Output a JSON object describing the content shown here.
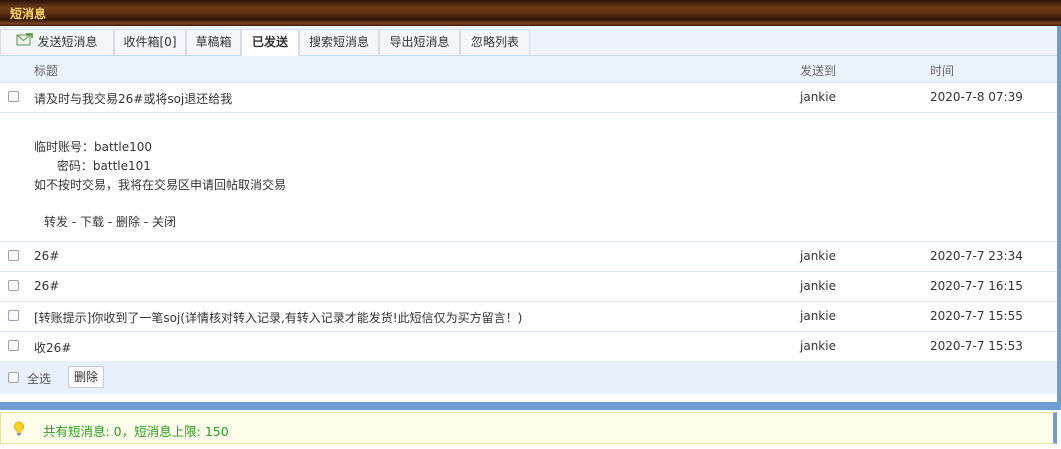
{
  "header": {
    "title": "短消息"
  },
  "tabs": [
    {
      "label": "发送短消息",
      "icon": "compose-envelope-icon"
    },
    {
      "label": "收件箱[0]"
    },
    {
      "label": "草稿箱"
    },
    {
      "label": "已发送",
      "active": true
    },
    {
      "label": "搜索短消息"
    },
    {
      "label": "导出短消息"
    },
    {
      "label": "忽略列表"
    }
  ],
  "columns": {
    "subject": "标题",
    "to": "发送到",
    "time": "时间"
  },
  "messages": [
    {
      "subject": "请及时与我交易26#或将soj退还给我",
      "to": "jankie",
      "time": "2020-7-8 07:39"
    },
    {
      "subject": "26#",
      "to": "jankie",
      "time": "2020-7-7 23:34"
    },
    {
      "subject": "26#",
      "to": "jankie",
      "time": "2020-7-7 16:15"
    },
    {
      "subject": "[转账提示]你收到了一笔soj(详情核对转入记录,有转入记录才能发货!此短信仅为买方留言！)",
      "to": "jankie",
      "time": "2020-7-7 15:55"
    },
    {
      "subject": "收26#",
      "to": "jankie",
      "time": "2020-7-7 15:53"
    }
  ],
  "detail": {
    "lines": [
      "临时账号：battle100",
      "      密码：battle101",
      "如不按时交易，我将在交易区申请回帖取消交易"
    ],
    "actions": {
      "forward": "转发",
      "download": "下载",
      "delete": "删除",
      "close": "关闭",
      "sep": " - "
    }
  },
  "footer": {
    "select_all": "全选",
    "delete_button": "删除"
  },
  "notice": {
    "text": "共有短消息: 0，短消息上限: 150",
    "icon": "lightbulb-icon"
  },
  "colors": {
    "accent": "#6f9fd2",
    "header_title": "#f7d36a",
    "notice_text": "#2e9a22"
  }
}
